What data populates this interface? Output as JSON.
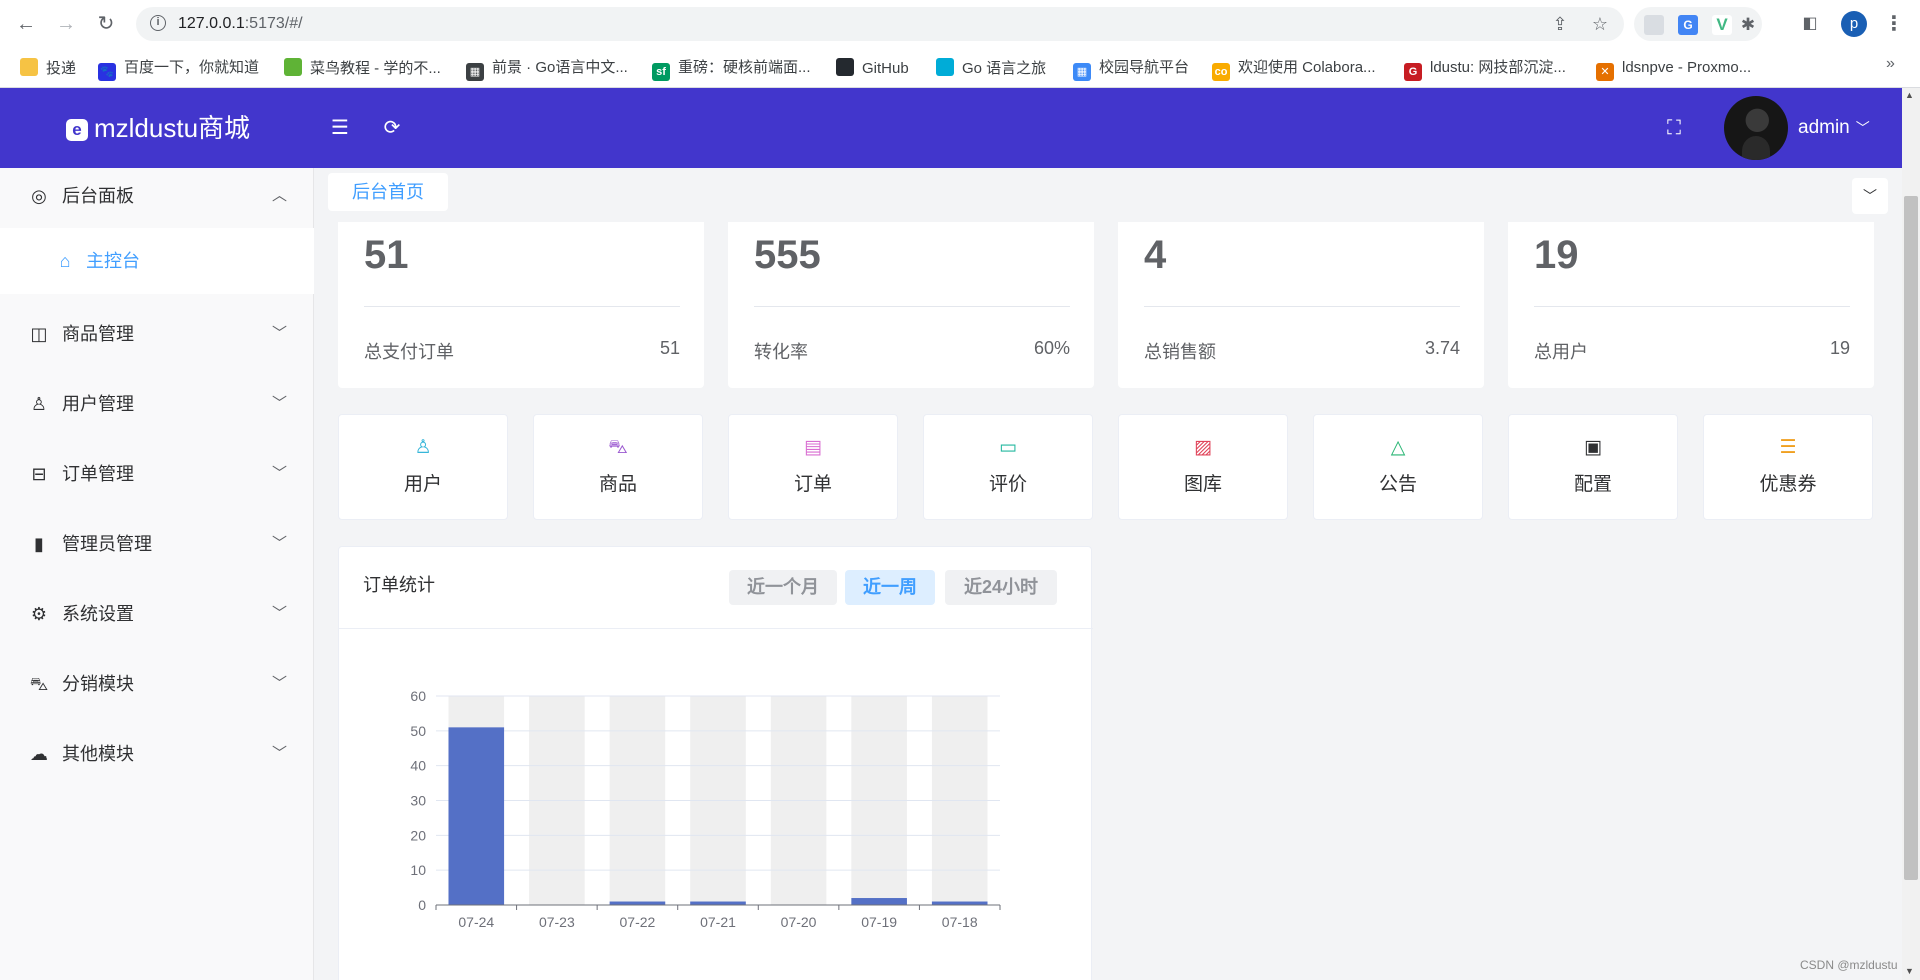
{
  "browser": {
    "url_host": "127.0.0.1",
    "url_rest": ":5173/#/",
    "bookmarks": [
      {
        "label": "投递",
        "icon": "folder-icon",
        "color": "#f6c344"
      },
      {
        "label": "百度一下，你就知道",
        "icon": "baidu-paw-icon",
        "color": "#2932e1"
      },
      {
        "label": "菜鸟教程 - 学的不...",
        "icon": "runoob-icon",
        "color": "#5fb336"
      },
      {
        "label": "前景 · Go语言中文...",
        "icon": "book-icon",
        "color": "#3c4043"
      },
      {
        "label": "重磅：硬核前端面...",
        "icon": "sf-icon",
        "color": "#009a61"
      },
      {
        "label": "GitHub",
        "icon": "github-icon",
        "color": "#24292f"
      },
      {
        "label": "Go 语言之旅",
        "icon": "gopher-icon",
        "color": "#00acd7"
      },
      {
        "label": "校园导航平台",
        "icon": "grid-icon",
        "color": "#3d8af7"
      },
      {
        "label": "欢迎使用 Colabora...",
        "icon": "colab-icon",
        "color": "#f9ab00"
      },
      {
        "label": "ldustu: 网技部沉淀...",
        "icon": "gitee-icon",
        "color": "#c71d23"
      },
      {
        "label": "ldsnpve - Proxmo...",
        "icon": "proxmox-icon",
        "color": "#e57000"
      }
    ]
  },
  "header": {
    "brand": "mzldustu商城",
    "user": "admin"
  },
  "sidebar": {
    "items": [
      {
        "label": "后台面板",
        "icon": "dashboard-icon",
        "arrow": "up"
      },
      {
        "label": "主控台",
        "icon": "home-icon",
        "sub": true
      },
      {
        "label": "商品管理",
        "icon": "shopping-bag-icon"
      },
      {
        "label": "用户管理",
        "icon": "user-icon"
      },
      {
        "label": "订单管理",
        "icon": "inbox-icon"
      },
      {
        "label": "管理员管理",
        "icon": "notebook-icon"
      },
      {
        "label": "系统设置",
        "icon": "gear-icon"
      },
      {
        "label": "分销模块",
        "icon": "cart-icon"
      },
      {
        "label": "其他模块",
        "icon": "cloud-icon"
      }
    ]
  },
  "tabs": {
    "active": "后台首页"
  },
  "stats": [
    {
      "value": "51",
      "label": "总支付订单",
      "sub": "51"
    },
    {
      "value": "555",
      "label": "转化率",
      "sub": "60%"
    },
    {
      "value": "4",
      "label": "总销售额",
      "sub": "3.74"
    },
    {
      "value": "19",
      "label": "总用户",
      "sub": "19"
    }
  ],
  "quick_nav": [
    {
      "label": "用户",
      "icon": "user-icon",
      "color": "#36b6d9"
    },
    {
      "label": "商品",
      "icon": "cart-icon",
      "color": "#9b59d0"
    },
    {
      "label": "订单",
      "icon": "document-icon",
      "color": "#d96ed2"
    },
    {
      "label": "评价",
      "icon": "chat-icon",
      "color": "#25b8a0"
    },
    {
      "label": "图库",
      "icon": "picture-icon",
      "color": "#e0445a"
    },
    {
      "label": "公告",
      "icon": "bell-icon",
      "color": "#27b573"
    },
    {
      "label": "配置",
      "icon": "settings-card-icon",
      "color": "#303133"
    },
    {
      "label": "优惠券",
      "icon": "coupon-icon",
      "color": "#f0a020"
    }
  ],
  "order_stats": {
    "title": "订单统计",
    "ranges": [
      "近一个月",
      "近一周",
      "近24小时"
    ],
    "active_range": "近一周"
  },
  "chart_data": {
    "type": "bar",
    "categories": [
      "07-24",
      "07-23",
      "07-22",
      "07-21",
      "07-20",
      "07-19",
      "07-18"
    ],
    "values": [
      51,
      0,
      1,
      1,
      0,
      2,
      1
    ],
    "ylim": [
      0,
      60
    ],
    "yticks": [
      0,
      10,
      20,
      30,
      40,
      50,
      60
    ],
    "bar_color": "#5470c6",
    "background_bar_color": "#efefef"
  },
  "watermark": "CSDN @mzldustu"
}
